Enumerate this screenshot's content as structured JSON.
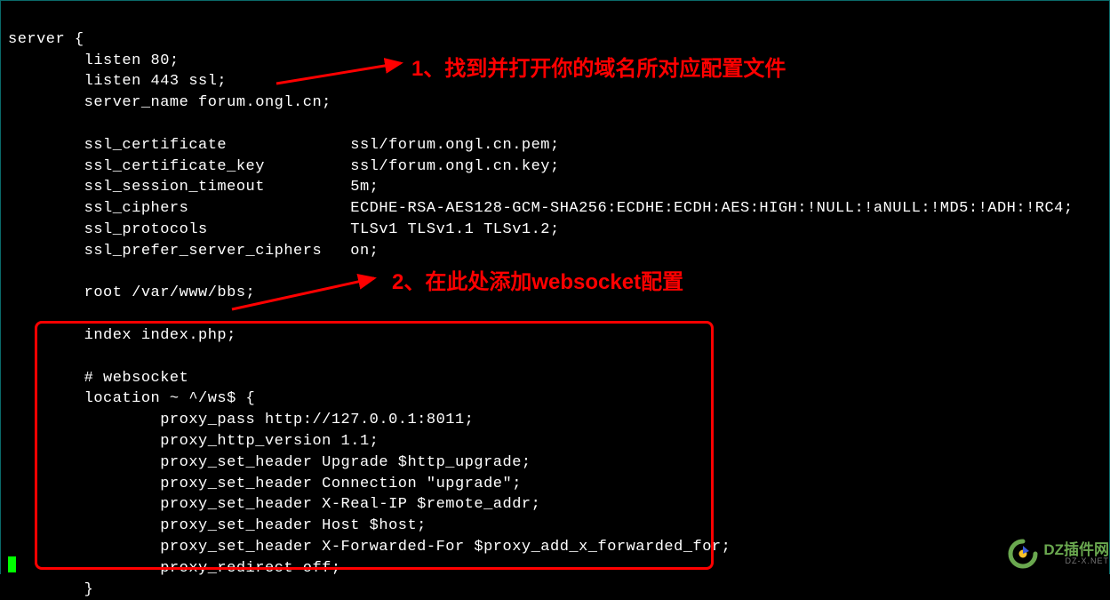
{
  "annotations": {
    "anno1": "1、找到并打开你的域名所对应配置文件",
    "anno2": "2、在此处添加websocket配置"
  },
  "watermark": {
    "title": "DZ插件网",
    "url": "DZ-X.NET"
  },
  "config": {
    "open": "server {",
    "listen80": "        listen 80;",
    "listen443": "        listen 443 ssl;",
    "server_name": "        server_name forum.ongl.cn;",
    "ssl_cert": "        ssl_certificate             ssl/forum.ongl.cn.pem;",
    "ssl_cert_key": "        ssl_certificate_key         ssl/forum.ongl.cn.key;",
    "ssl_timeout": "        ssl_session_timeout         5m;",
    "ssl_ciphers": "        ssl_ciphers                 ECDHE-RSA-AES128-GCM-SHA256:ECDHE:ECDH:AES:HIGH:!NULL:!aNULL:!MD5:!ADH:!RC4;",
    "ssl_protocols": "        ssl_protocols               TLSv1 TLSv1.1 TLSv1.2;",
    "ssl_prefer": "        ssl_prefer_server_ciphers   on;",
    "root": "        root /var/www/bbs;",
    "index": "        index index.php;",
    "ws_comment": "        # websocket",
    "ws_loc": "        location ~ ^/ws$ {",
    "ws_pass": "                proxy_pass http://127.0.0.1:8011;",
    "ws_http": "                proxy_http_version 1.1;",
    "ws_upgrade": "                proxy_set_header Upgrade $http_upgrade;",
    "ws_conn": "                proxy_set_header Connection \"upgrade\";",
    "ws_realip": "                proxy_set_header X-Real-IP $remote_addr;",
    "ws_host": "                proxy_set_header Host $host;",
    "ws_fwd": "                proxy_set_header X-Forwarded-For $proxy_add_x_forwarded_for;",
    "ws_redir": "                proxy_redirect off;",
    "ws_close": "        }"
  }
}
